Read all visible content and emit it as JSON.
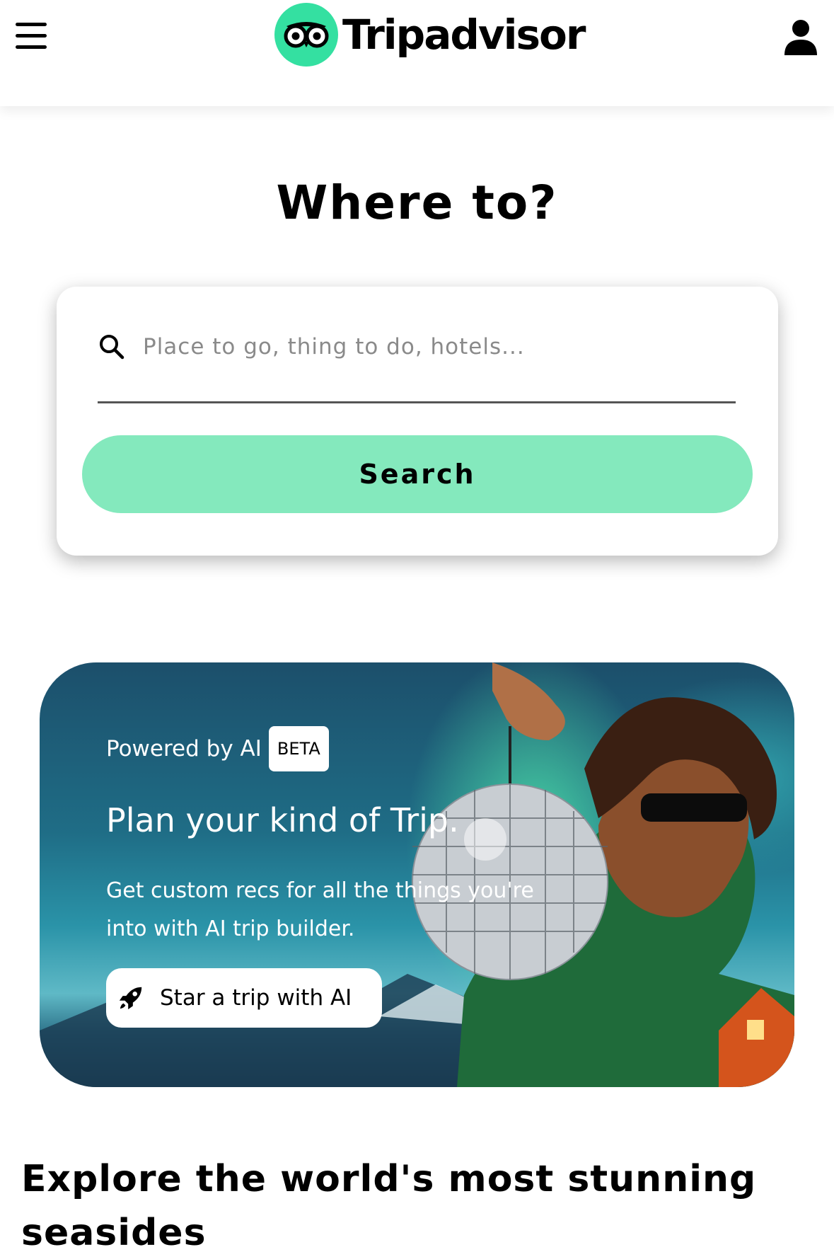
{
  "header": {
    "brand_name": "Tripadvisor",
    "menu_icon": "hamburger-menu-icon",
    "logo_icon": "owl-eyes-logo-icon",
    "profile_icon": "user-profile-icon",
    "brand_color": "#34e0a1"
  },
  "hero": {
    "title": "Where to?"
  },
  "search": {
    "placeholder": "Place to go, thing to do, hotels...",
    "value": "",
    "icon": "search-icon",
    "button_label": "Search",
    "button_color": "#84e9bd"
  },
  "ai_banner": {
    "powered_label": "Powered by AI",
    "badge": "BETA",
    "headline": "Plan your kind of Trip.",
    "description": "Get custom recs for all the things you're into with AI trip builder.",
    "button_label": "Star a trip with AI",
    "button_icon": "rocket-icon"
  },
  "section": {
    "heading": "Explore the world's most stunning seasides"
  }
}
